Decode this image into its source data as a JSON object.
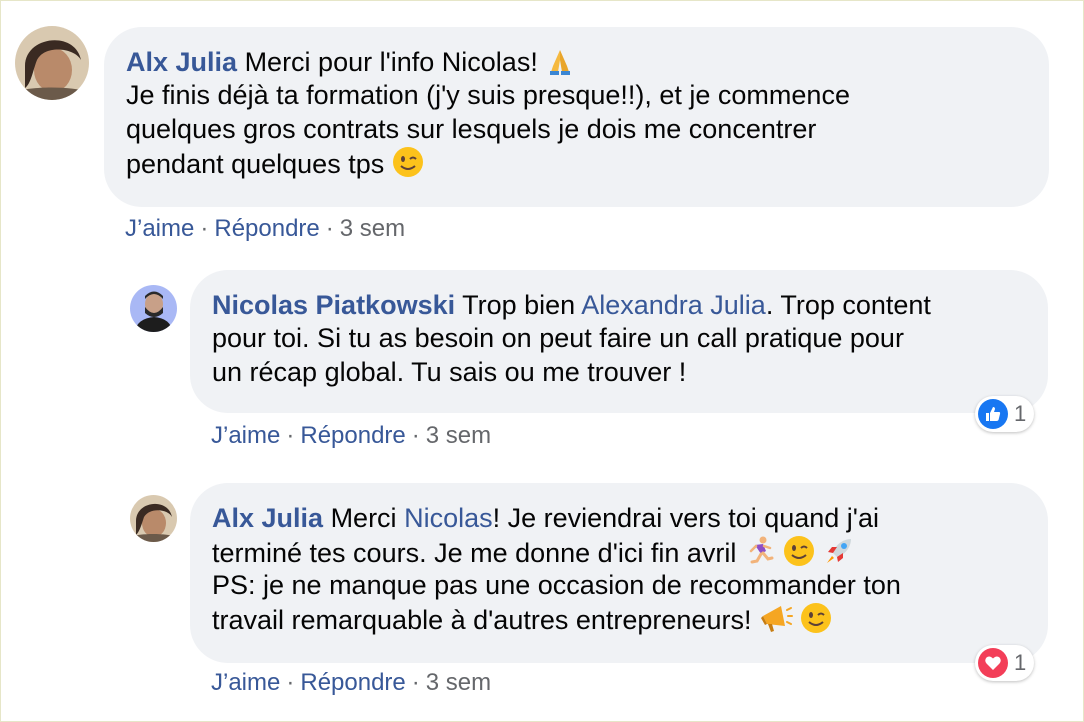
{
  "comments": [
    {
      "author": "Alx Julia",
      "text_1": "Merci pour l'info Nicolas!",
      "text_2": "Je finis déjà ta formation (j'y suis presque!!), et je commence",
      "text_3": "quelques gros contrats sur lesquels je dois me concentrer",
      "text_4": "pendant quelques tps",
      "like_label": "J’aime",
      "reply_label": "Répondre",
      "time": "3 sem",
      "emojis": [
        "folded-hands",
        "winking-face"
      ]
    },
    {
      "author": "Nicolas Piatkowski",
      "text_1a": "Trop bien",
      "mention": "Alexandra Julia",
      "text_1b": ". Trop content",
      "text_2": "pour toi. Si tu as besoin on peut faire un call pratique pour",
      "text_3": "un récap global. Tu sais ou me trouver !",
      "like_label": "J’aime",
      "reply_label": "Répondre",
      "time": "3 sem",
      "reaction": {
        "type": "like",
        "count": "1",
        "color": "#1877f2"
      }
    },
    {
      "author": "Alx Julia",
      "text_1a": "Merci",
      "mention": "Nicolas",
      "text_1b": "! Je reviendrai vers toi quand j'ai",
      "text_2": "terminé tes cours. Je me donne d'ici fin avril",
      "text_3": "PS: je ne manque pas une occasion de recommander ton",
      "text_4": "travail remarquable à d'autres entrepreneurs!",
      "like_label": "J’aime",
      "reply_label": "Répondre",
      "time": "3 sem",
      "emojis": [
        "runner",
        "winking-face",
        "rocket",
        "megaphone",
        "winking-face"
      ],
      "reaction": {
        "type": "love",
        "count": "1",
        "color": "#f33e58"
      }
    }
  ],
  "colors": {
    "link": "#385898",
    "bubble": "#f0f2f5",
    "meta": "#65676b"
  }
}
